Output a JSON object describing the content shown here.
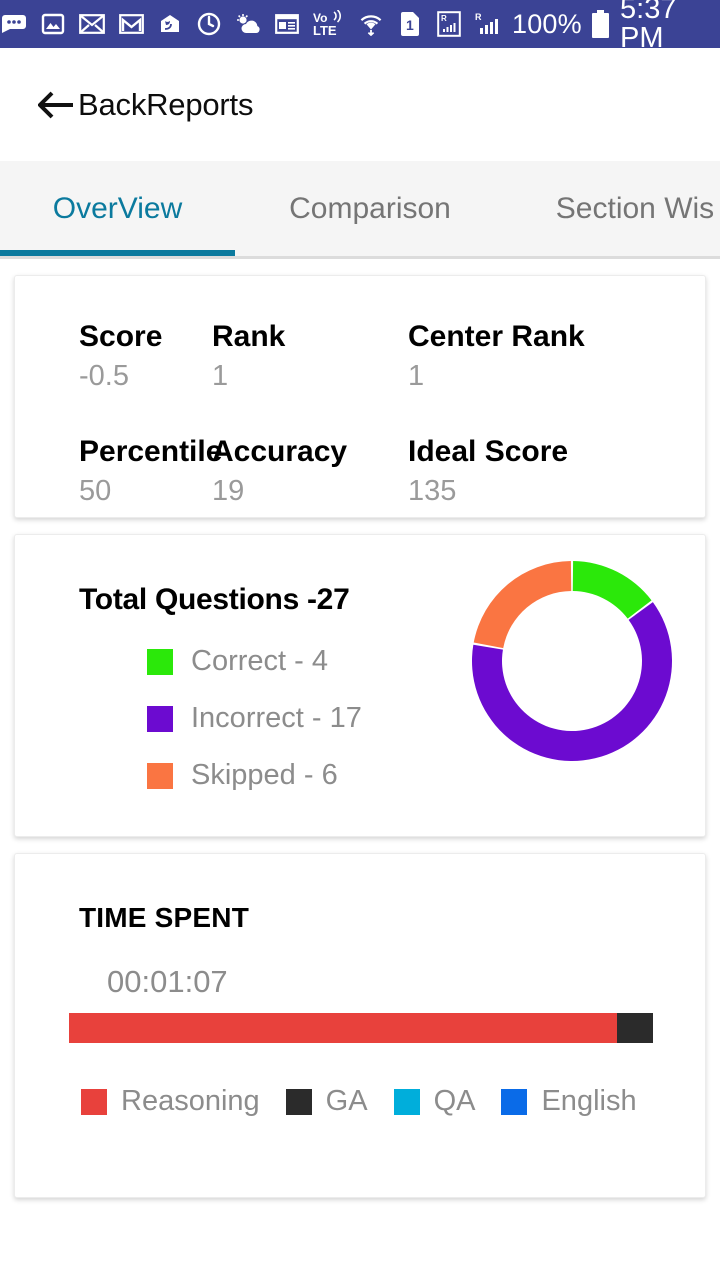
{
  "status_bar": {
    "background": "#3b4395",
    "battery_text": "100%",
    "time": "5:37 PM",
    "network_label": "LTE",
    "volte_label": "Vo)",
    "sim_label": "1",
    "roam_label": "R",
    "icons": [
      "chat-bubble-icon",
      "photo-icon",
      "email-icon",
      "gmail-icon",
      "app-icon",
      "clock-ring-icon",
      "weather-icon",
      "news-icon",
      "volte-icon",
      "wifi-icon",
      "sim-card-icon",
      "signal-roaming-icon",
      "signal-bars-icon",
      "battery-icon"
    ]
  },
  "appbar": {
    "back_icon": "back-arrow-icon",
    "title": "BackReports"
  },
  "tabs": {
    "active_index": 0,
    "accent": "#0b7a9e",
    "items": [
      {
        "label": "OverView"
      },
      {
        "label": "Comparison"
      },
      {
        "label": "Section Wis"
      }
    ]
  },
  "stats_card": {
    "rows": [
      [
        {
          "label": "Score",
          "value": "-0.5"
        },
        {
          "label": "Rank",
          "value": "1"
        },
        {
          "label": "Center Rank",
          "value": "1"
        }
      ],
      [
        {
          "label": "Percentile",
          "value": "50"
        },
        {
          "label": "Accuracy",
          "value": "19"
        },
        {
          "label": "Ideal Score",
          "value": "135"
        }
      ]
    ]
  },
  "questions_card": {
    "title": "Total Questions -27",
    "legend": [
      {
        "label": "Correct - 4",
        "color": "#2be80a"
      },
      {
        "label": "Incorrect - 17",
        "color": "#6c0bd0"
      },
      {
        "label": "Skipped - 6",
        "color": "#fa7542"
      }
    ]
  },
  "time_card": {
    "title": "TIME SPENT",
    "total_time": "00:01:07",
    "segments": [
      {
        "label": "Reasoning",
        "color": "#e8413c",
        "percent": 93.8
      },
      {
        "label": "GA",
        "color": "#2b2b2b",
        "percent": 6.2
      }
    ],
    "legend": [
      {
        "label": "Reasoning",
        "color": "#e8413c"
      },
      {
        "label": "GA",
        "color": "#2b2b2b"
      },
      {
        "label": "QA",
        "color": "#00aedb"
      },
      {
        "label": "English",
        "color": "#0a6be8"
      }
    ]
  },
  "chart_data": [
    {
      "type": "pie",
      "title": "Total Questions -27",
      "labels": [
        "Correct",
        "Incorrect",
        "Skipped"
      ],
      "values": [
        4,
        17,
        6
      ],
      "colors": [
        "#2be80a",
        "#6c0bd0",
        "#fa7542"
      ],
      "total": 27,
      "donut": true,
      "inner_radius_ratio": 0.7,
      "start_angle_deg": -90,
      "legend_position": "left"
    },
    {
      "type": "bar",
      "title": "TIME SPENT",
      "orientation": "horizontal",
      "stacked": true,
      "categories": [
        "Time Spent"
      ],
      "series": [
        {
          "name": "Reasoning",
          "values": [
            93.8
          ],
          "color": "#e8413c"
        },
        {
          "name": "GA",
          "values": [
            6.2
          ],
          "color": "#2b2b2b"
        },
        {
          "name": "QA",
          "values": [
            0
          ],
          "color": "#00aedb"
        },
        {
          "name": "English",
          "values": [
            0
          ],
          "color": "#0a6be8"
        }
      ],
      "annotation": "00:01:07",
      "ylabel": "",
      "xlabel": "",
      "grid": false,
      "legend_position": "bottom"
    }
  ]
}
